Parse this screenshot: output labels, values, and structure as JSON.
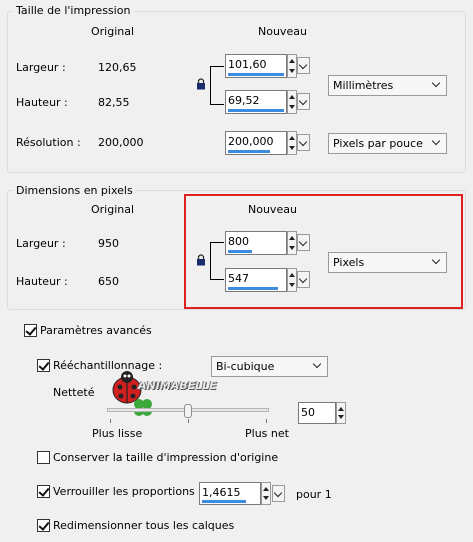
{
  "print_size": {
    "title": "Taille de l'impression",
    "col_original": "Original",
    "col_new": "Nouveau",
    "width_label": "Largeur :",
    "height_label": "Hauteur :",
    "resolution_label": "Résolution :",
    "orig_width": "120,65",
    "orig_height": "82,55",
    "orig_resolution": "200,000",
    "new_width": "101,60",
    "new_height": "69,52",
    "new_resolution": "200,000",
    "unit": "Millimètres",
    "resolution_unit": "Pixels par pouce"
  },
  "pixel_dims": {
    "title": "Dimensions en pixels",
    "col_original": "Original",
    "col_new": "Nouveau",
    "width_label": "Largeur :",
    "height_label": "Hauteur :",
    "orig_width": "950",
    "orig_height": "650",
    "new_width": "800",
    "new_height": "547",
    "unit": "Pixels",
    "highlight_color": "#e02020"
  },
  "advanced": {
    "label": "Paramètres avancés",
    "checked": true,
    "resample_label": "Rééchantillonnage :",
    "resample_checked": true,
    "resample_method": "Bi-cubique",
    "sharpness_label": "Netteté",
    "sharpness_value": "50",
    "sharpness_level": 0.5,
    "smoother_label": "Plus lisse",
    "sharper_label": "Plus net",
    "watermark_text": "ANIMABELLE",
    "keep_print_size_label": "Conserver la taille d'impression d'origine",
    "keep_print_size_checked": false,
    "lock_ratio_label": "Verrouiller les proportions :",
    "lock_ratio_checked": true,
    "ratio_value": "1,4615",
    "ratio_suffix": "pour 1",
    "resize_layers_label": "Redimensionner tous les calques",
    "resize_layers_checked": true
  },
  "colors": {
    "accent_bar": "#3c8be0",
    "highlight": "#e02020",
    "ladybug": "#d21f1f",
    "clover": "#3aa83a"
  }
}
